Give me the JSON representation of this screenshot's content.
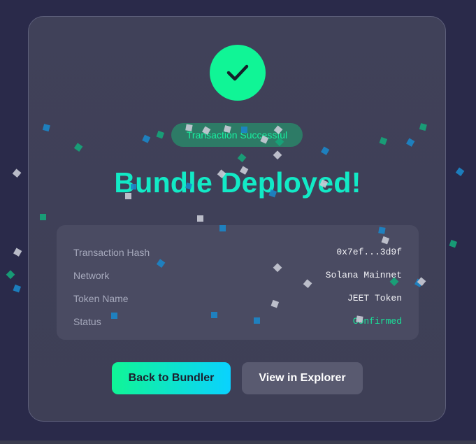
{
  "modal": {
    "badge": "Transaction Successful",
    "title": "Bundle Deployed!",
    "details": [
      {
        "label": "Transaction Hash",
        "value": "0x7ef...3d9f"
      },
      {
        "label": "Network",
        "value": "Solana Mainnet"
      },
      {
        "label": "Token Name",
        "value": "JEET Token"
      },
      {
        "label": "Status",
        "value": "Confirmed"
      }
    ],
    "buttons": {
      "back": "Back to Bundler",
      "explorer": "View in Explorer"
    }
  },
  "icons": {
    "success": "check-icon"
  },
  "colors": {
    "accent_green": "#10f596",
    "accent_cyan": "#0ad2ff",
    "title": "#12eac6",
    "status_confirmed": "#18e69a"
  }
}
